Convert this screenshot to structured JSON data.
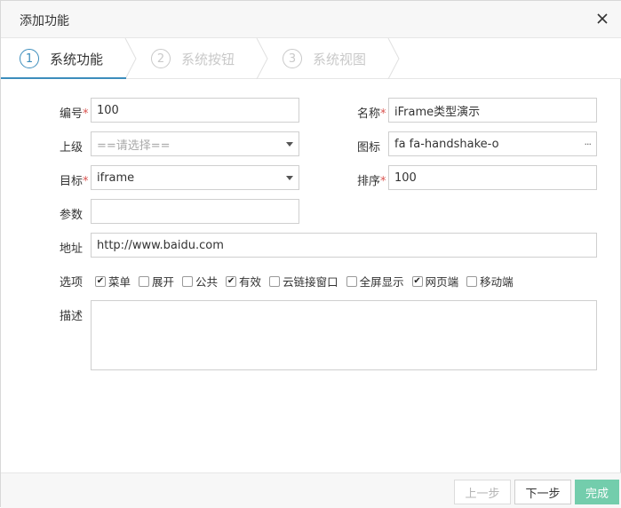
{
  "dialog": {
    "title": "添加功能"
  },
  "steps": [
    {
      "num": "1",
      "label": "系统功能"
    },
    {
      "num": "2",
      "label": "系统按钮"
    },
    {
      "num": "3",
      "label": "系统视图"
    }
  ],
  "form": {
    "code": {
      "label": "编号",
      "value": "100"
    },
    "name": {
      "label": "名称",
      "value": "iFrame类型演示"
    },
    "parent": {
      "label": "上级",
      "placeholder": "==请选择=="
    },
    "icon": {
      "label": "图标",
      "value": "fa fa-handshake-o",
      "picker": "···"
    },
    "target": {
      "label": "目标",
      "value": "iframe"
    },
    "sort": {
      "label": "排序",
      "value": "100"
    },
    "params": {
      "label": "参数",
      "value": ""
    },
    "address": {
      "label": "地址",
      "value": "http://www.baidu.com"
    },
    "options_label": "选项",
    "options": [
      {
        "label": "菜单",
        "checked": true
      },
      {
        "label": "展开",
        "checked": false
      },
      {
        "label": "公共",
        "checked": false
      },
      {
        "label": "有效",
        "checked": true
      },
      {
        "label": "云链接窗口",
        "checked": false
      },
      {
        "label": "全屏显示",
        "checked": false
      },
      {
        "label": "网页端",
        "checked": true
      },
      {
        "label": "移动端",
        "checked": false
      }
    ],
    "description": {
      "label": "描述",
      "value": ""
    },
    "required_mark": "*"
  },
  "footer": {
    "prev": "上一步",
    "next": "下一步",
    "finish": "完成"
  },
  "colors": {
    "accent": "#3c8dbc",
    "required": "#d9534f",
    "finish": "#5cc6a0"
  }
}
